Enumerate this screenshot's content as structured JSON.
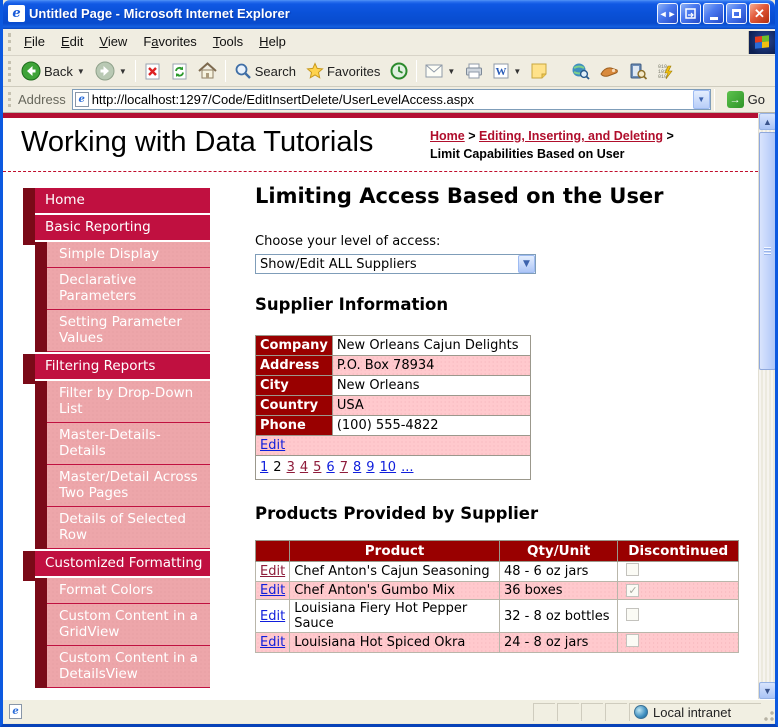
{
  "window": {
    "title": "Untitled Page - Microsoft Internet Explorer"
  },
  "menu_bar": {
    "items": [
      {
        "label": "File",
        "accel": 0
      },
      {
        "label": "Edit",
        "accel": 0
      },
      {
        "label": "View",
        "accel": 0
      },
      {
        "label": "Favorites",
        "accel": 1
      },
      {
        "label": "Tools",
        "accel": 0
      },
      {
        "label": "Help",
        "accel": 0
      }
    ]
  },
  "toolbar": {
    "back_label": "Back",
    "search_label": "Search",
    "favorites_label": "Favorites"
  },
  "address_bar": {
    "label": "Address",
    "url": "http://localhost:1297/Code/EditInsertDelete/UserLevelAccess.aspx",
    "go_label": "Go"
  },
  "status_bar": {
    "zone_label": "Local intranet"
  },
  "page": {
    "site_title": "Working with Data Tutorials",
    "breadcrumb": {
      "links": [
        "Home",
        "Editing, Inserting, and Deleting"
      ],
      "separator": ">",
      "current": "Limit Capabilities Based on User"
    },
    "sidebar": {
      "sections": [
        {
          "header": "Home",
          "items": []
        },
        {
          "header": "Basic Reporting",
          "items": [
            "Simple Display",
            "Declarative Parameters",
            "Setting Parameter Values"
          ]
        },
        {
          "header": "Filtering Reports",
          "items": [
            "Filter by Drop-Down List",
            "Master-Details-Details",
            "Master/Detail Across Two Pages",
            "Details of Selected Row"
          ]
        },
        {
          "header": "Customized Formatting",
          "items": [
            "Format Colors",
            "Custom Content in a GridView",
            "Custom Content in a DetailsView"
          ]
        }
      ]
    },
    "main": {
      "heading": "Limiting Access Based on the User",
      "access_label": "Choose your level of access:",
      "access_value": "Show/Edit ALL Suppliers",
      "supplier_heading": "Supplier Information",
      "supplier": {
        "rows": [
          {
            "label": "Company",
            "value": "New Orleans Cajun Delights"
          },
          {
            "label": "Address",
            "value": "P.O. Box 78934"
          },
          {
            "label": "City",
            "value": "New Orleans"
          },
          {
            "label": "Country",
            "value": "USA"
          },
          {
            "label": "Phone",
            "value": "(100) 555-4822"
          }
        ],
        "edit_label": "Edit",
        "pager": [
          {
            "label": "1",
            "state": "link"
          },
          {
            "label": "2",
            "state": "current"
          },
          {
            "label": "3",
            "state": "visited"
          },
          {
            "label": "4",
            "state": "visited"
          },
          {
            "label": "5",
            "state": "visited"
          },
          {
            "label": "6",
            "state": "link"
          },
          {
            "label": "7",
            "state": "visited"
          },
          {
            "label": "8",
            "state": "link"
          },
          {
            "label": "9",
            "state": "link"
          },
          {
            "label": "10",
            "state": "link"
          },
          {
            "label": "...",
            "state": "link"
          }
        ]
      },
      "products_heading": "Products Provided by Supplier",
      "products": {
        "headers": [
          "",
          "Product",
          "Qty/Unit",
          "Discontinued"
        ],
        "edit_label": "Edit",
        "rows": [
          {
            "edit_state": "visited",
            "product": "Chef Anton's Cajun Seasoning",
            "qty": "48 - 6 oz jars",
            "discontinued": false
          },
          {
            "edit_state": "link",
            "product": "Chef Anton's Gumbo Mix",
            "qty": "36 boxes",
            "discontinued": true
          },
          {
            "edit_state": "link",
            "product": "Louisiana Fiery Hot Pepper Sauce",
            "qty": "32 - 8 oz bottles",
            "discontinued": false
          },
          {
            "edit_state": "link",
            "product": "Louisiana Hot Spiced Okra",
            "qty": "24 - 8 oz jars",
            "discontinued": false
          }
        ]
      }
    }
  },
  "colors": {
    "crimson_bar": "#c01040",
    "dark_maroon": "#7a0a18",
    "table_header_red": "#990000",
    "sidebar_pink": "#eda6aa",
    "row_pink": "#ffc9cd",
    "accent_red_bar": "#b30e32",
    "link_blue": "#0f1edc",
    "link_visited": "#8e1b3a",
    "titlebar_blue": "#0a51d8"
  }
}
